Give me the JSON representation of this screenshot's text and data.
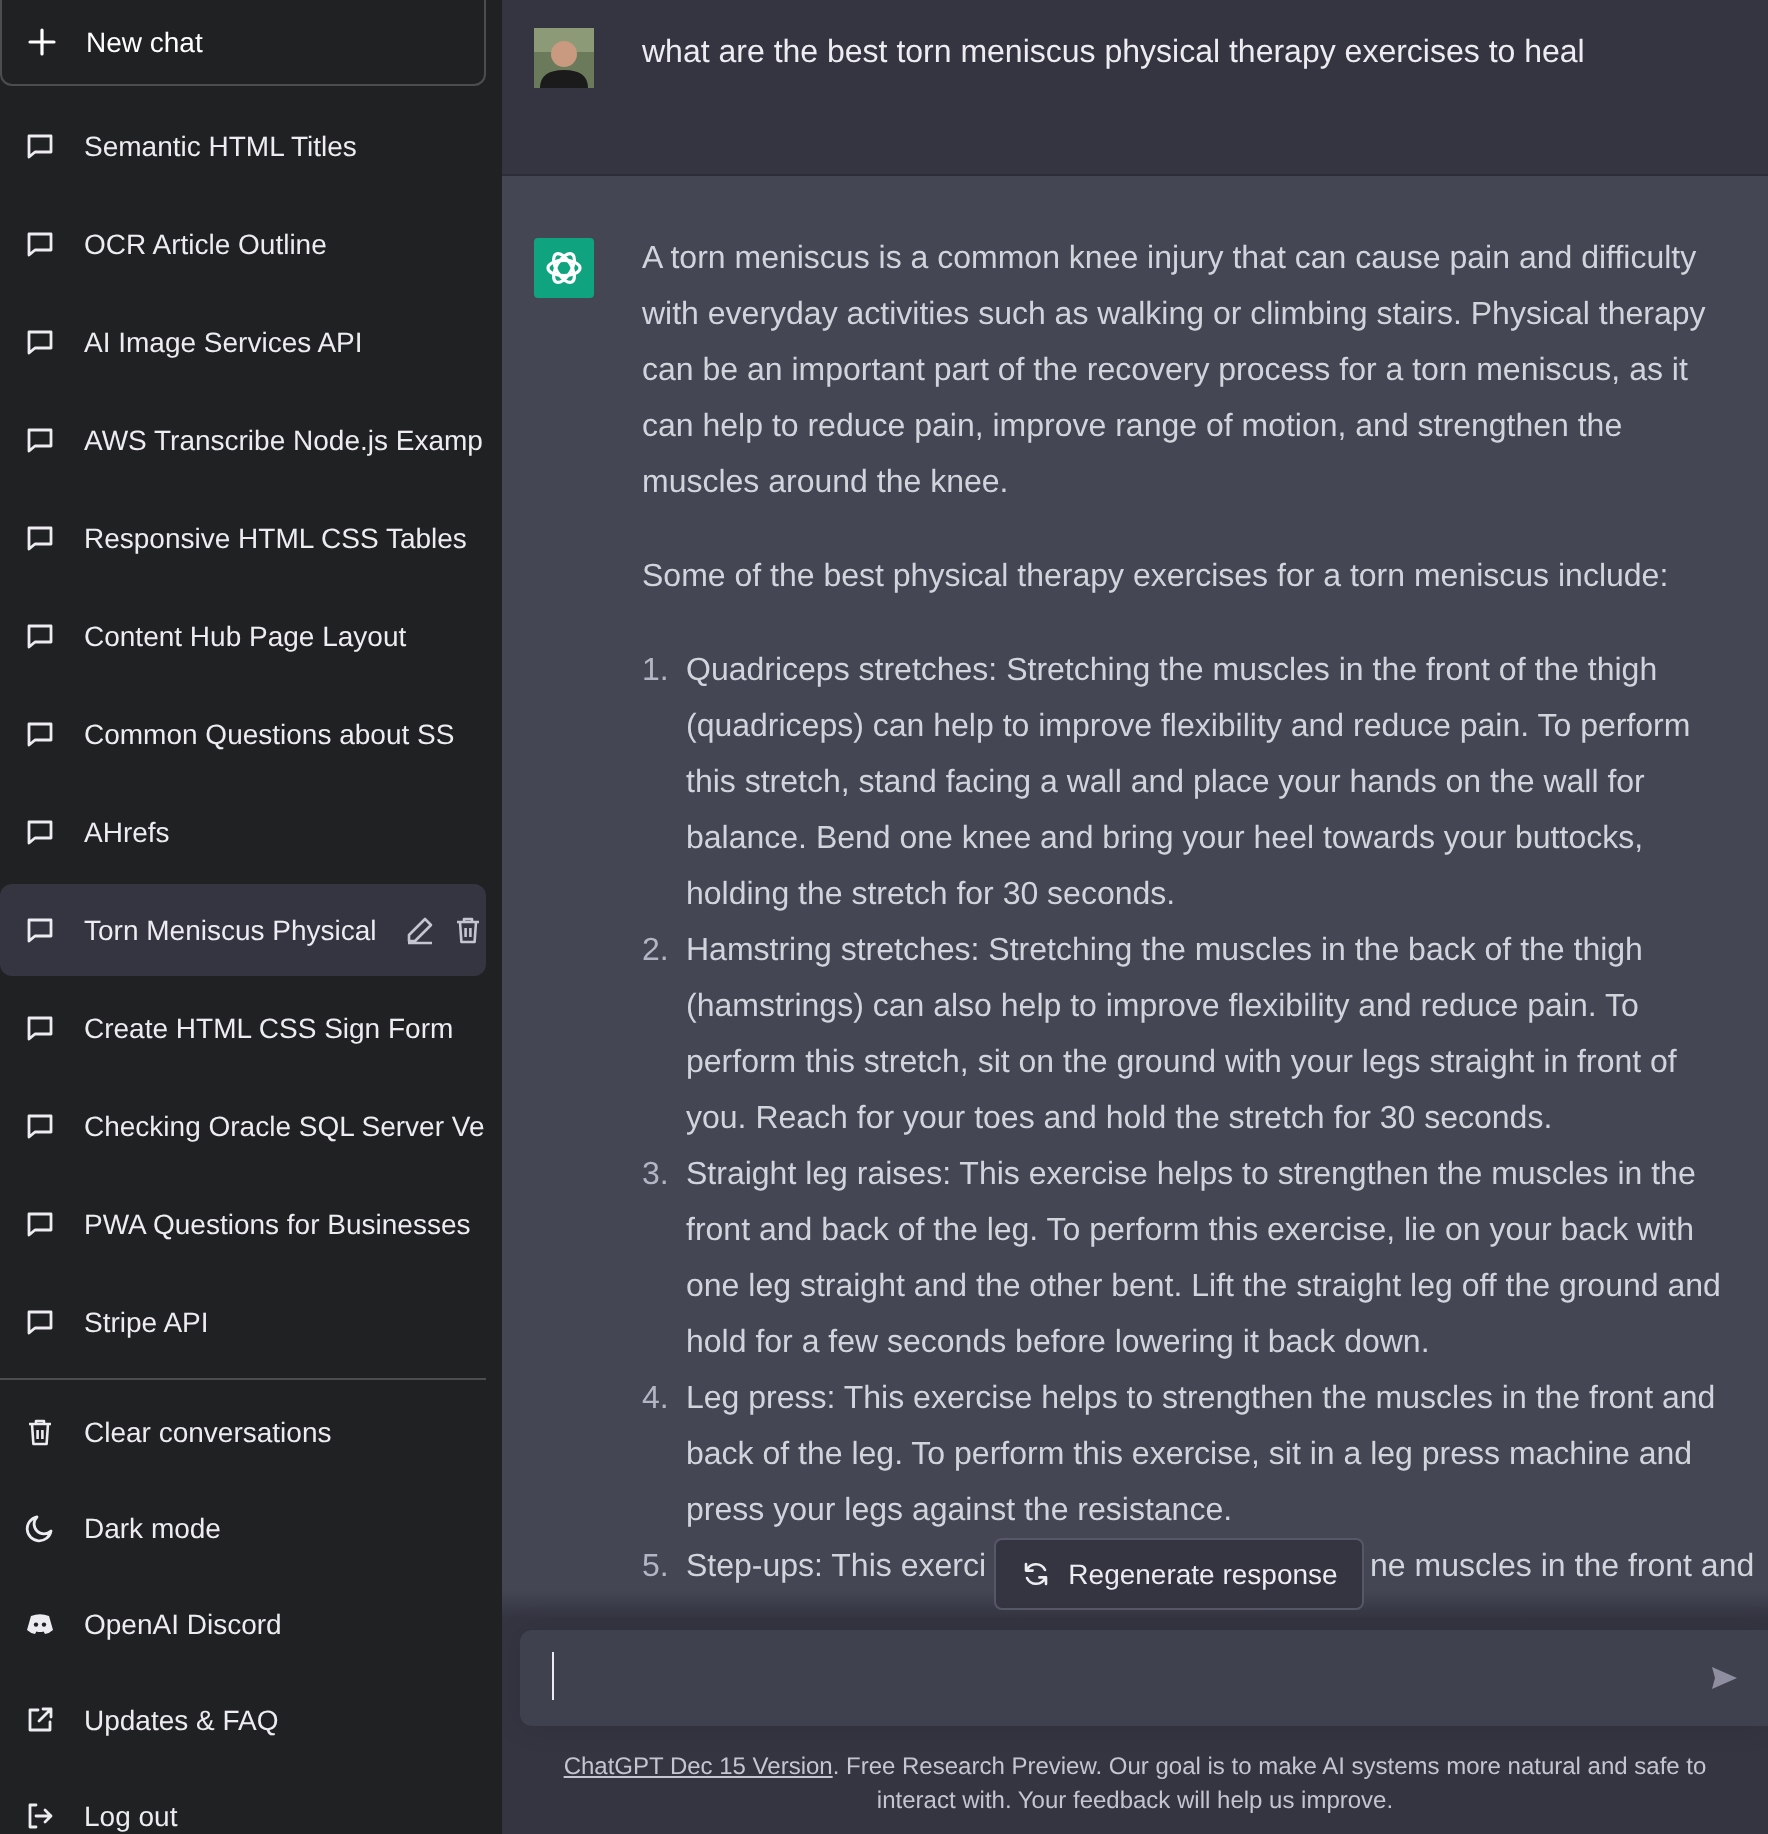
{
  "sidebar": {
    "new_chat": {
      "label": "New chat"
    },
    "conversations": [
      {
        "title": "Semantic HTML Titles",
        "selected": false
      },
      {
        "title": "OCR Article Outline",
        "selected": false
      },
      {
        "title": "AI Image Services API",
        "selected": false
      },
      {
        "title": "AWS Transcribe Node.js Examp",
        "selected": false
      },
      {
        "title": "Responsive HTML CSS Tables",
        "selected": false
      },
      {
        "title": "Content Hub Page Layout",
        "selected": false
      },
      {
        "title": "Common Questions about SS",
        "selected": false
      },
      {
        "title": "AHrefs",
        "selected": false
      },
      {
        "title": "Torn Meniscus Physical",
        "selected": true
      },
      {
        "title": "Create HTML CSS Sign Form",
        "selected": false
      },
      {
        "title": "Checking Oracle SQL Server Ve",
        "selected": false
      },
      {
        "title": "PWA Questions for Businesses",
        "selected": false
      },
      {
        "title": "Stripe API",
        "selected": false
      }
    ],
    "actions": [
      {
        "kind": "clear",
        "label": "Clear conversations"
      },
      {
        "kind": "theme",
        "label": "Dark mode"
      },
      {
        "kind": "discord",
        "label": "OpenAI Discord"
      },
      {
        "kind": "link",
        "label": "Updates & FAQ"
      },
      {
        "kind": "logout",
        "label": "Log out"
      }
    ]
  },
  "messages": [
    {
      "kind": "user",
      "text": "what are the best torn meniscus physical therapy exercises to heal"
    },
    {
      "kind": "assistant",
      "paragraphs": [
        "A torn meniscus is a common knee injury that can cause pain and difficulty with everyday activities such as walking or climbing stairs. Physical therapy can be an important part of the recovery process for a torn meniscus, as it can help to reduce pain, improve range of motion, and strengthen the muscles around the knee.",
        "Some of the best physical therapy exercises for a torn meniscus include:"
      ],
      "list": [
        {
          "number": "1.",
          "text": "Quadriceps stretches: Stretching the muscles in the front of the thigh (quadriceps) can help to improve flexibility and reduce pain. To perform this stretch, stand facing a wall and place your hands on the wall for balance. Bend one knee and bring your heel towards your buttocks, holding the stretch for 30 seconds."
        },
        {
          "number": "2.",
          "text": "Hamstring stretches: Stretching the muscles in the back of the thigh (hamstrings) can also help to improve flexibility and reduce pain. To perform this stretch, sit on the ground with your legs straight in front of you. Reach for your toes and hold the stretch for 30 seconds."
        },
        {
          "number": "3.",
          "text": "Straight leg raises: This exercise helps to strengthen the muscles in the front and back of the leg. To perform this exercise, lie on your back with one leg straight and the other bent. Lift the straight leg off the ground and hold for a few seconds before lowering it back down."
        },
        {
          "number": "4.",
          "text": "Leg press: This exercise helps to strengthen the muscles in the front and back of the leg. To perform this exercise, sit in a leg press machine and press your legs against the resistance."
        },
        {
          "number": "5.",
          "text": "Step-ups: This exerci",
          "text_after": "ne muscles in the front and"
        }
      ]
    }
  ],
  "regenerate_button": {
    "label": "Regenerate response"
  },
  "footer": {
    "link": "ChatGPT Dec 15 Version",
    "text": ". Free Research Preview. Our goal is to make AI systems more natural and safe to interact with. Your feedback will help us improve."
  }
}
